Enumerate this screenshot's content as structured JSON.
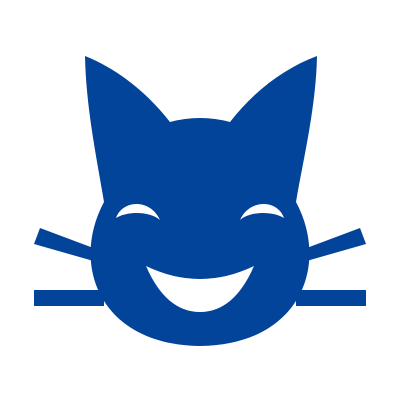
{
  "icon": {
    "name": "grinning-cat-smiling-eyes-icon",
    "colors": {
      "fill": "#03449B",
      "cutout": "#FFFFFF",
      "background": "#FFFFFF"
    }
  }
}
